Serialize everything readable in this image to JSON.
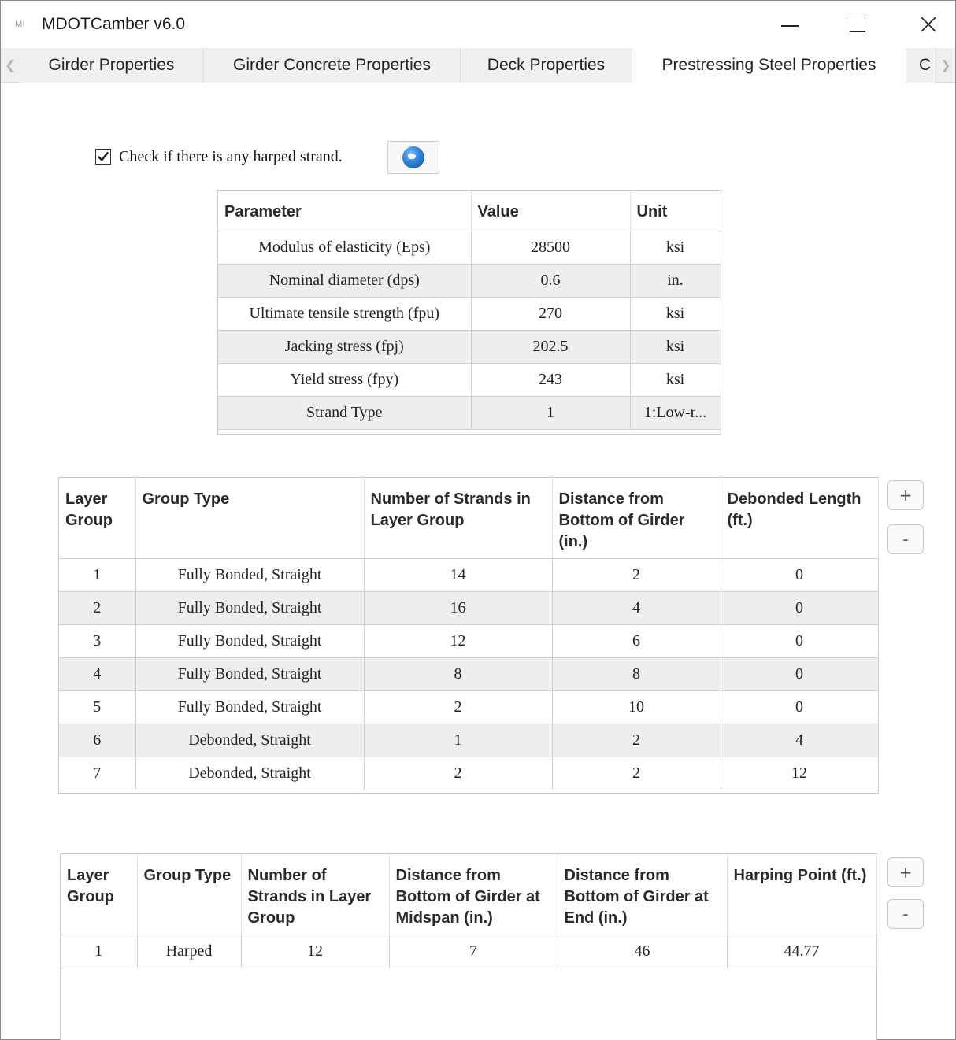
{
  "window": {
    "icon_text": "MI",
    "title": "MDOTCamber v6.0"
  },
  "tabs": [
    {
      "label": "Girder Properties"
    },
    {
      "label": "Girder Concrete Properties"
    },
    {
      "label": "Deck Properties"
    },
    {
      "label": "Prestressing Steel Properties"
    },
    {
      "label": "C"
    }
  ],
  "harped": {
    "checked": true,
    "label": "Check if there is any harped strand."
  },
  "param_table": {
    "headers": [
      "Parameter",
      "Value",
      "Unit"
    ],
    "rows": [
      [
        "Modulus of elasticity (Eps)",
        "28500",
        "ksi"
      ],
      [
        "Nominal diameter (dps)",
        "0.6",
        "in."
      ],
      [
        "Ultimate tensile strength (fpu)",
        "270",
        "ksi"
      ],
      [
        "Jacking stress (fpj)",
        "202.5",
        "ksi"
      ],
      [
        "Yield stress (fpy)",
        "243",
        "ksi"
      ],
      [
        "Strand Type",
        "1",
        "1:Low-r..."
      ]
    ]
  },
  "layer_table": {
    "headers": [
      "Layer Group",
      "Group Type",
      "Number of Strands in Layer Group",
      "Distance from Bottom of Girder (in.)",
      "Debonded Length (ft.)"
    ],
    "rows": [
      [
        "1",
        "Fully Bonded, Straight",
        "14",
        "2",
        "0"
      ],
      [
        "2",
        "Fully Bonded, Straight",
        "16",
        "4",
        "0"
      ],
      [
        "3",
        "Fully Bonded, Straight",
        "12",
        "6",
        "0"
      ],
      [
        "4",
        "Fully Bonded, Straight",
        "8",
        "8",
        "0"
      ],
      [
        "5",
        "Fully Bonded, Straight",
        "2",
        "10",
        "0"
      ],
      [
        "6",
        "Debonded, Straight",
        "1",
        "2",
        "4"
      ],
      [
        "7",
        "Debonded, Straight",
        "2",
        "2",
        "12"
      ]
    ],
    "add_label": "+",
    "remove_label": "-"
  },
  "harp_table": {
    "headers": [
      "Layer Group",
      "Group Type",
      "Number of Strands in Layer Group",
      "Distance from Bottom of Girder at Midspan (in.)",
      "Distance from Bottom of Girder at End (in.)",
      "Harping Point (ft.)"
    ],
    "rows": [
      [
        "1",
        "Harped",
        "12",
        "7",
        "46",
        "44.77"
      ]
    ],
    "add_label": "+",
    "remove_label": "-"
  }
}
